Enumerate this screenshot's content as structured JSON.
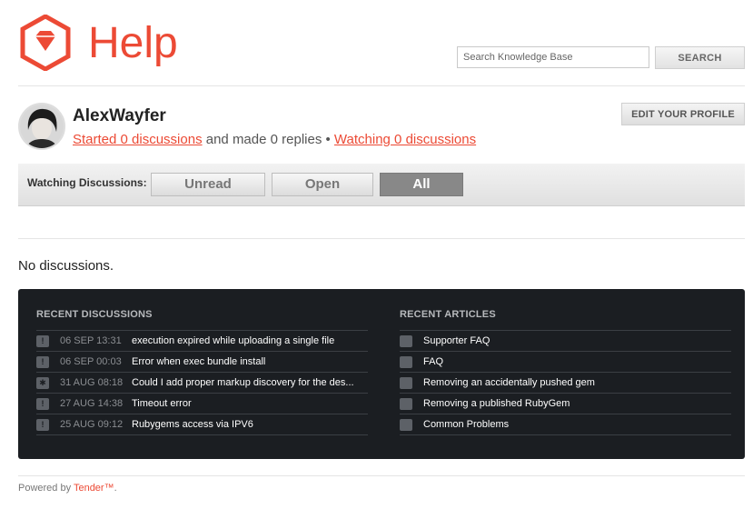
{
  "header": {
    "logo_text": "Help",
    "search_placeholder": "Search Knowledge Base",
    "search_button": "SEARCH",
    "brand_color": "#ec4a35"
  },
  "profile": {
    "username": "AlexWayfer",
    "started_link": "Started 0 discussions",
    "replies_text": " and made 0 replies • ",
    "watching_link": "Watching 0 discussions",
    "edit_button": "EDIT YOUR PROFILE"
  },
  "filter": {
    "label": "Watching Discussions:",
    "buttons": [
      "Unread",
      "Open",
      "All"
    ],
    "active": "All"
  },
  "empty_message": "No discussions.",
  "recent_discussions": {
    "title": "RECENT DISCUSSIONS",
    "items": [
      {
        "icon": "warning-icon",
        "date": "06 SEP 13:31",
        "title": "execution expired while uploading a single file"
      },
      {
        "icon": "warning-icon",
        "date": "06 SEP 00:03",
        "title": "Error when exec bundle install"
      },
      {
        "icon": "asterisk-icon",
        "date": "31 AUG 08:18",
        "title": "Could I add proper markup discovery for the des..."
      },
      {
        "icon": "warning-icon",
        "date": "27 AUG 14:38",
        "title": "Timeout error"
      },
      {
        "icon": "warning-icon",
        "date": "25 AUG 09:12",
        "title": "Rubygems access via IPV6"
      }
    ]
  },
  "recent_articles": {
    "title": "RECENT ARTICLES",
    "items": [
      {
        "icon": "folder-icon",
        "title": "Supporter FAQ"
      },
      {
        "icon": "folder-icon",
        "title": "FAQ"
      },
      {
        "icon": "folder-icon",
        "title": "Removing an accidentally pushed gem"
      },
      {
        "icon": "folder-icon",
        "title": "Removing a published RubyGem"
      },
      {
        "icon": "folder-icon",
        "title": "Common Problems"
      }
    ]
  },
  "footer": {
    "prefix": "Powered by ",
    "link": "Tender™",
    "suffix": "."
  }
}
